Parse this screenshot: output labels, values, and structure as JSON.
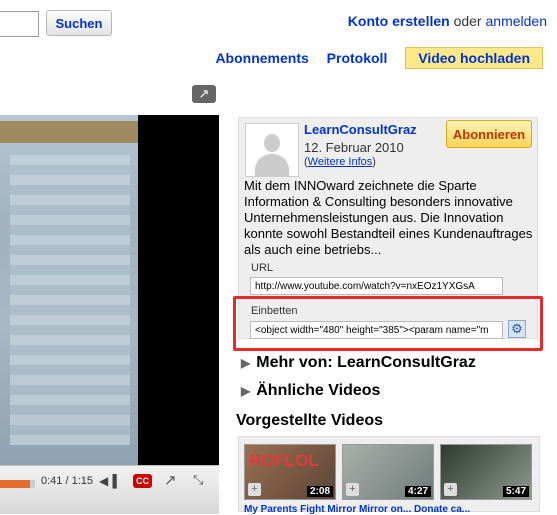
{
  "header": {
    "search_button": "Suchen",
    "account_create": "Konto erstellen",
    "or": "oder",
    "login": "anmelden",
    "nav": [
      "Abonnements",
      "Protokoll"
    ],
    "upload": "Video hochladen"
  },
  "player": {
    "time": "0:41 / 1:15",
    "cc": "CC",
    "progress_fraction": 0.55
  },
  "channel": {
    "name": "LearnConsultGraz",
    "date": "12. Februar 2010",
    "more_info_prefix": "(",
    "more_info": "Weitere Infos",
    "more_info_suffix": ")",
    "subscribe": "Abonnieren",
    "description": "Mit dem INNOward zeichnete die Sparte Information & Consulting besonders innovative Unternehmensleistungen aus. Die Innovation konnte sowohl Bestandteil eines Kundenauftrages als auch eine betriebs...",
    "url_label": "URL",
    "url_value": "http://www.youtube.com/watch?v=nxEOz1YXGsA",
    "embed_label": "Einbetten",
    "embed_value": "<object width=\"480\" height=\"385\"><param name=\"m"
  },
  "related": {
    "more_from": "Mehr von: LearnConsultGraz",
    "similar": "Ähnliche Videos",
    "featured_title": "Vorgestellte Videos",
    "thumbs": [
      {
        "duration": "2:08",
        "overlay": "ROFLOL"
      },
      {
        "duration": "4:27"
      },
      {
        "duration": "5:47"
      }
    ],
    "thumb_titles": "My Parents Fight  Mirror Mirror on...  Donate ca..."
  }
}
